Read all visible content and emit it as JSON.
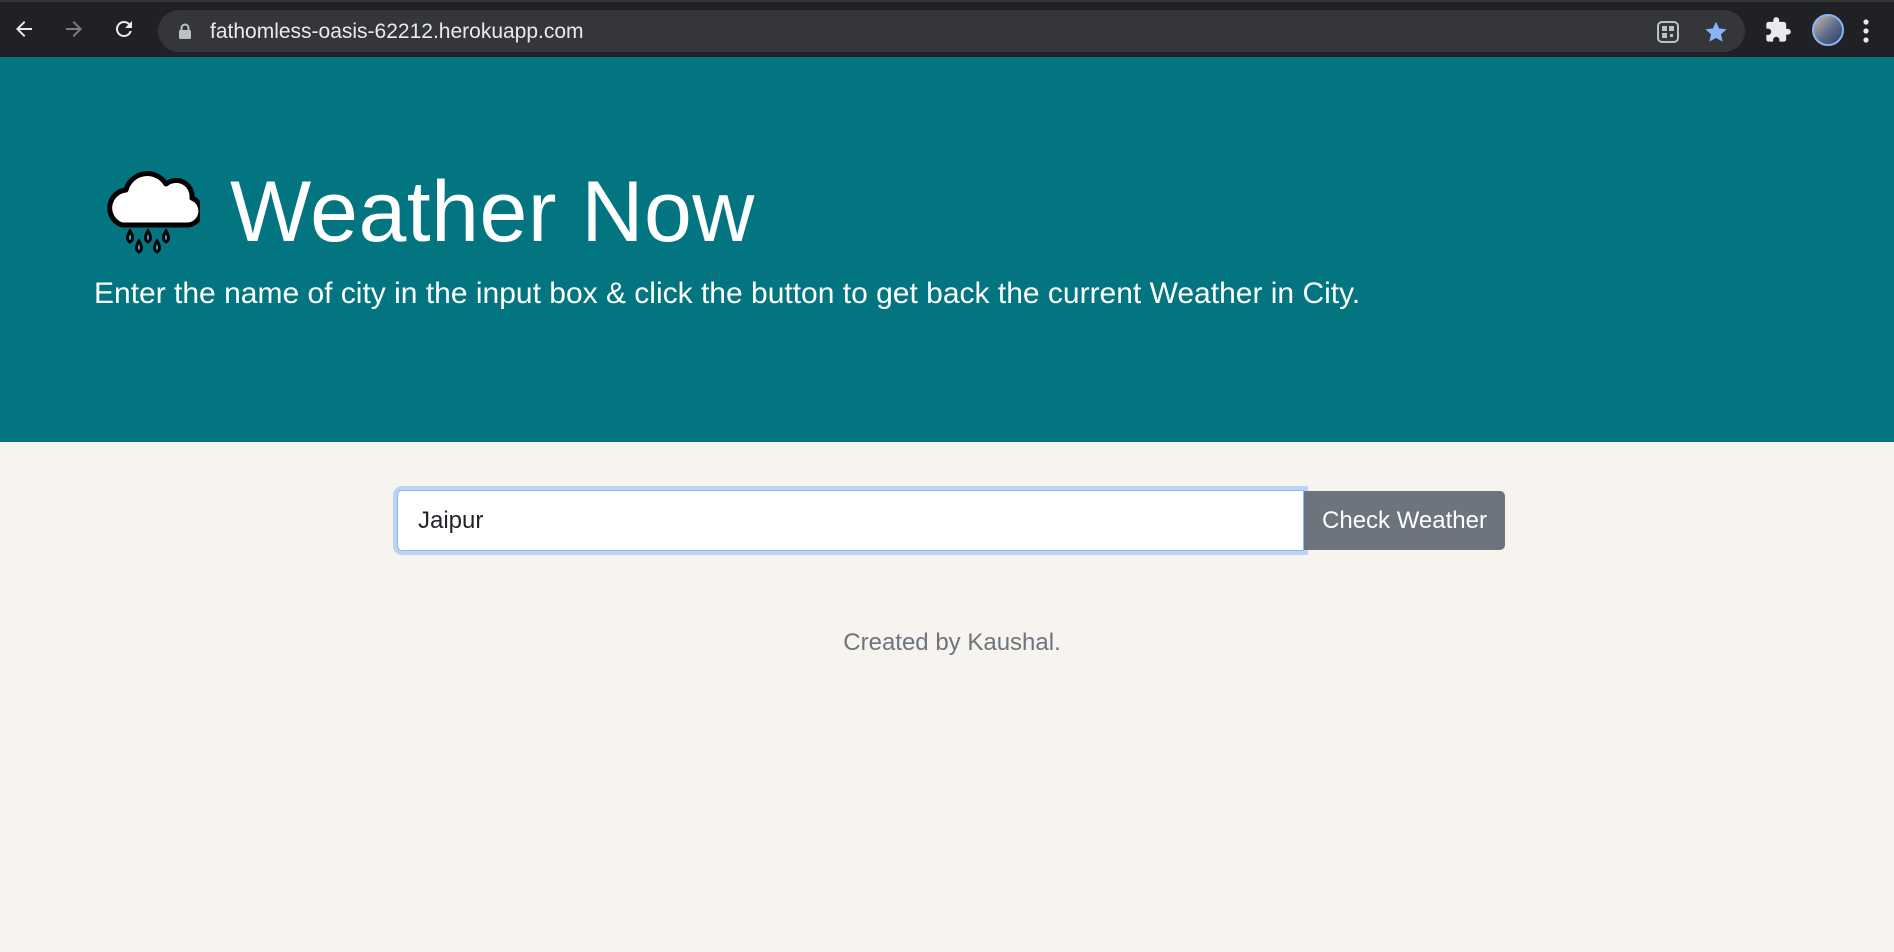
{
  "browser": {
    "url": "fathomless-oasis-62212.herokuapp.com",
    "icons": {
      "back": "arrow-left-icon",
      "forward": "arrow-right-icon",
      "reload": "reload-icon",
      "lock": "lock-icon",
      "qr": "qr-code-icon",
      "bookmark": "star-icon",
      "extensions": "puzzle-icon",
      "menu": "kebab-menu-icon"
    },
    "colors": {
      "bookmark_star": "#8ab4f8",
      "chrome_bg": "#202124",
      "omnibox_bg": "#35363a"
    }
  },
  "hero": {
    "emoji_icon": "cloud-with-rain-icon",
    "title": "Weather Now",
    "subtitle": "Enter the name of city in the input box & click the button to get back the current Weather in City.",
    "background": "#037580"
  },
  "form": {
    "city_value": "Jaipur",
    "button_label": "Check Weather",
    "button_color": "#6c757d"
  },
  "footer": {
    "text": "Created by Kaushal."
  }
}
